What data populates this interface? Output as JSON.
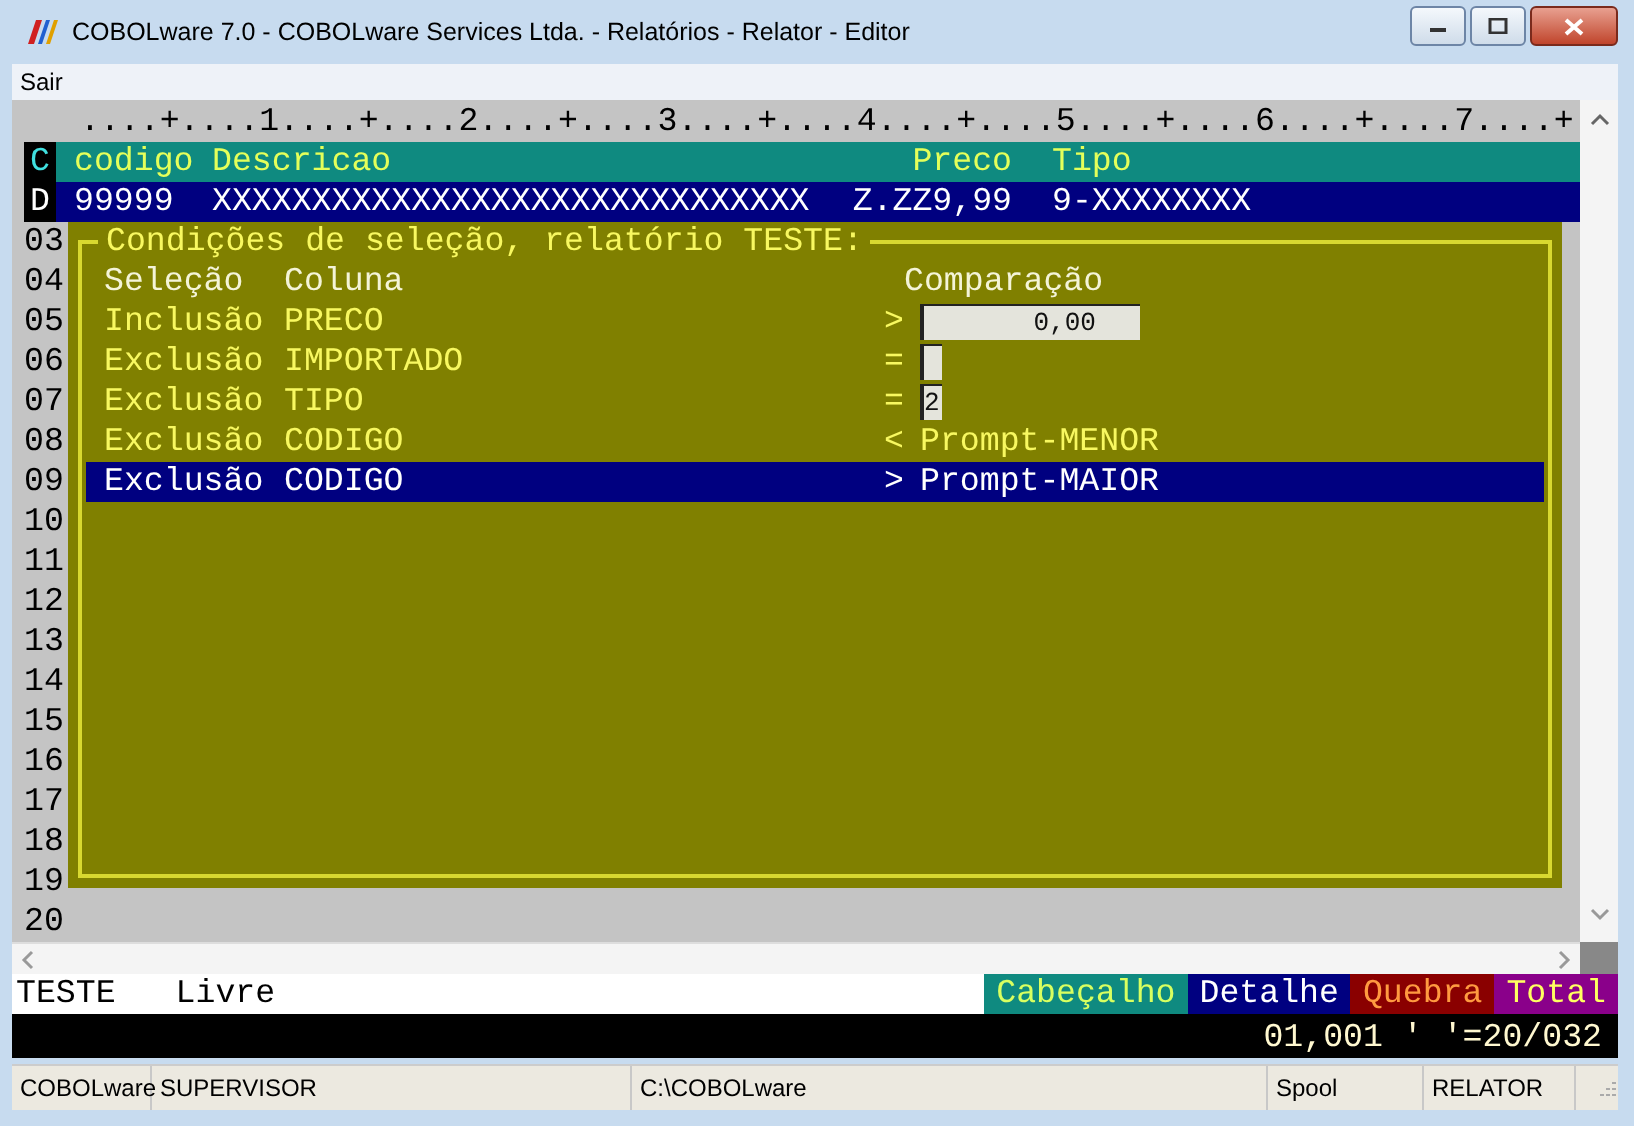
{
  "window": {
    "title": "COBOLware 7.0 - COBOLware Services Ltda. - Relatórios - Relator - Editor"
  },
  "menu": [
    {
      "label": "Sair"
    }
  ],
  "ruler": "....+....1....+....2....+....3....+....4....+....5....+....6....+....7....+",
  "header_row": {
    "marker": "C",
    "cells": [
      "codigo",
      "Descricao",
      "Preco",
      "Tipo"
    ]
  },
  "detail_row": {
    "marker": "D",
    "cells": [
      "99999",
      "XXXXXXXXXXXXXXXXXXXXXXXXXXXXXX",
      "Z.ZZ9,99",
      "9-XXXXXXXX"
    ]
  },
  "line_numbers": [
    "03",
    "04",
    "05",
    "06",
    "07",
    "08",
    "09",
    "10",
    "11",
    "12",
    "13",
    "14",
    "15",
    "16",
    "17",
    "18",
    "19",
    "20"
  ],
  "dialog": {
    "title": "Condições de seleção, relatório TESTE:",
    "headers": [
      "Seleção",
      "Coluna",
      "Comparação"
    ],
    "rows": [
      {
        "selection": "Inclusão",
        "column": "PRECO",
        "operator": ">",
        "kind": "numeric-field",
        "value": "0,00",
        "selected": false
      },
      {
        "selection": "Exclusão",
        "column": "IMPORTADO",
        "operator": "=",
        "kind": "char-field",
        "value": "",
        "selected": false
      },
      {
        "selection": "Exclusão",
        "column": "TIPO",
        "operator": "=",
        "kind": "char-field",
        "value": "2",
        "selected": false
      },
      {
        "selection": "Exclusão",
        "column": "CODIGO",
        "operator": "<",
        "kind": "text",
        "value": "Prompt-MENOR",
        "selected": false
      },
      {
        "selection": "Exclusão",
        "column": "CODIGO",
        "operator": ">",
        "kind": "text",
        "value": "Prompt-MAIOR",
        "selected": true
      }
    ]
  },
  "mode": [
    "TESTE",
    "Livre"
  ],
  "sections": [
    {
      "label": "Cabeçalho",
      "kind": "header"
    },
    {
      "label": "Detalhe",
      "kind": "detail"
    },
    {
      "label": "Quebra",
      "kind": "break"
    },
    {
      "label": "Total",
      "kind": "total"
    }
  ],
  "cursor_line": "01,001 ' '=20/032",
  "status_bar": [
    "COBOLware",
    "SUPERVISOR",
    "C:\\COBOLware",
    "Spool",
    "RELATOR"
  ]
}
